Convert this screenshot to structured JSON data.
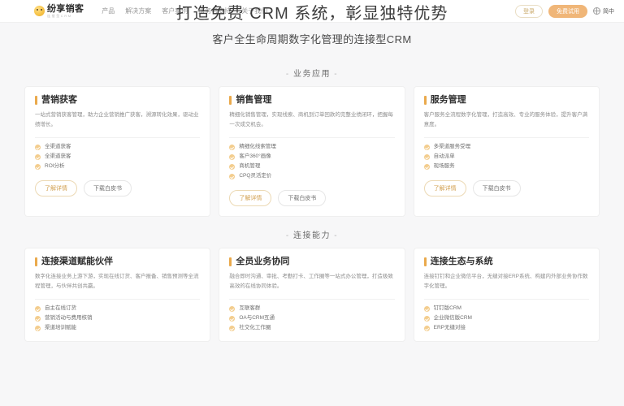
{
  "header": {
    "logo_title": "纷享销客",
    "logo_sub": "连接型CRM",
    "nav": [
      {
        "label": "产品"
      },
      {
        "label": "解决方案"
      },
      {
        "label": "客户案例"
      },
      {
        "label": "服务与支持"
      },
      {
        "label": "关于我们"
      }
    ],
    "login_label": "登录",
    "trial_label": "免费试用",
    "lang_label": "简中",
    "globe_icon": "globe-icon"
  },
  "hero": {
    "title": "打造免费 CRM 系统，彰显独特优势",
    "subtitle": "客户全生命周期数字化管理的连接型CRM"
  },
  "sections": [
    {
      "heading": "业务应用",
      "dash": "-",
      "cards": [
        {
          "title": "营销获客",
          "desc": "一站式营销获客管理，助力企业营销推广获客，溯源转化效果，驱动业绩增长。",
          "features": [
            "全渠道获客",
            "全渠道获客",
            "ROI分析"
          ],
          "primary_label": "了解详情",
          "secondary_label": "下载白皮书"
        },
        {
          "title": "销售管理",
          "desc": "精细化销售管理，实现线索、商机到订单回款的完整业绩闭环，把握每一次成交机会。",
          "features": [
            "精细化线索管理",
            "客户360°画像",
            "商机管理",
            "CPQ灵活定价"
          ],
          "primary_label": "了解详情",
          "secondary_label": "下载白皮书"
        },
        {
          "title": "服务管理",
          "desc": "客户服务全流程数字化管理，打造高效、专业的服务体验，提升客户满意度。",
          "features": [
            "多渠道服务受理",
            "自动派单",
            "现场服务"
          ],
          "primary_label": "了解详情",
          "secondary_label": "下载白皮书"
        }
      ]
    },
    {
      "heading": "连接能力",
      "dash": "-",
      "cards": [
        {
          "title": "连接渠道赋能伙伴",
          "desc": "数字化连接业务上游下游，实现在线订货、客户报备、销售预测等全流程管理，与伙伴共创共赢。",
          "features": [
            "自主在线订货",
            "营销活动与费用核销",
            "渠道培训赋能"
          ],
          "primary_label": "了解详情",
          "secondary_label": "下载白皮书"
        },
        {
          "title": "全员业务协同",
          "desc": "融合即时沟通、审批、考勤打卡、工作圈等一站式办公管理，打造极致高效的在线协同体验。",
          "features": [
            "互联客群",
            "OA与CRM互通",
            "社交化工作圈"
          ],
          "primary_label": "了解详情",
          "secondary_label": "下载白皮书"
        },
        {
          "title": "连接生态与系统",
          "desc": "连接钉钉和企业微信平台，无缝对接ERP系统、构建内外部业务协作数字化管理。",
          "features": [
            "钉钉版CRM",
            "企业微信版CRM",
            "ERP无缝对接"
          ],
          "primary_label": "了解详情",
          "secondary_label": "下载白皮书"
        }
      ]
    }
  ],
  "colors": {
    "accent": "#eaa94c",
    "trial_button": "#f0b678",
    "page_bg": "#f7f7f8",
    "card_bg": "#ffffff"
  }
}
